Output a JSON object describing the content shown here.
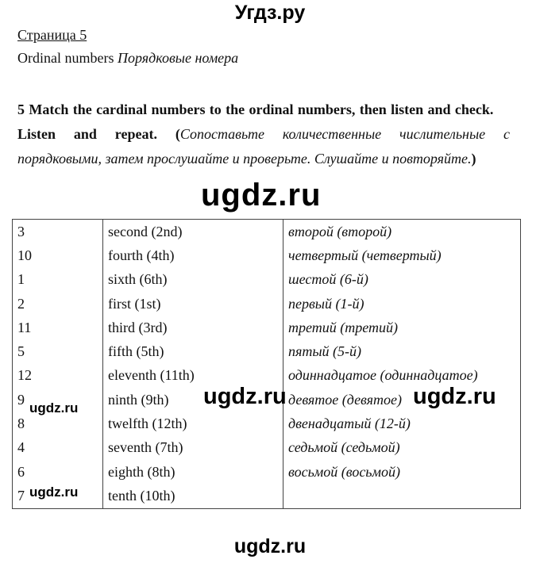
{
  "header": {
    "site_title": "Угдз.ру"
  },
  "page": {
    "label": "Страница 5",
    "topic_en": "Ordinal numbers",
    "topic_ru": "Порядковые номера"
  },
  "task": {
    "number_and_text": "5 Match the cardinal numbers to the ordinal numbers, then listen and check.",
    "text2": "Listen and repeat. (",
    "translation": "Сопоставьте количественные числительные с порядковыми, затем прослушайте и проверьте. Слушайте и повторяйте.",
    "close": ")"
  },
  "watermarks": {
    "main": "ugdz.ru",
    "mid_left": "ugdz.ru",
    "mid_right": "ugdz.ru",
    "small_1": "ugdz.ru",
    "small_2": "ugdz.ru",
    "footer": "ugdz.ru"
  },
  "table": {
    "rows": [
      {
        "cardinal": "3",
        "ordinal": "second (2nd)",
        "russian": "второй (второй)"
      },
      {
        "cardinal": "10",
        "ordinal": "fourth (4th)",
        "russian": "четвертый (четвертый)"
      },
      {
        "cardinal": "1",
        "ordinal": "sixth (6th)",
        "russian": "шестой (6-й)"
      },
      {
        "cardinal": "2",
        "ordinal": "first (1st)",
        "russian": "первый (1-й)"
      },
      {
        "cardinal": "11",
        "ordinal": "third (3rd)",
        "russian": "третий (третий)"
      },
      {
        "cardinal": "5",
        "ordinal": "fifth (5th)",
        "russian": "пятый (5-й)"
      },
      {
        "cardinal": "12",
        "ordinal": "eleventh (11th)",
        "russian": "одиннадцатое (одиннадцатое)"
      },
      {
        "cardinal": "9",
        "ordinal": "ninth (9th)",
        "russian": "девятое (девятое)"
      },
      {
        "cardinal": "8",
        "ordinal": "twelfth (12th)",
        "russian": "двенадцатый (12-й)"
      },
      {
        "cardinal": "4",
        "ordinal": "seventh (7th)",
        "russian": "седьмой (седьмой)"
      },
      {
        "cardinal": "6",
        "ordinal": "eighth (8th)",
        "russian": "восьмой (восьмой)"
      },
      {
        "cardinal": "7",
        "ordinal": "tenth (10th)",
        "russian": ""
      }
    ]
  }
}
